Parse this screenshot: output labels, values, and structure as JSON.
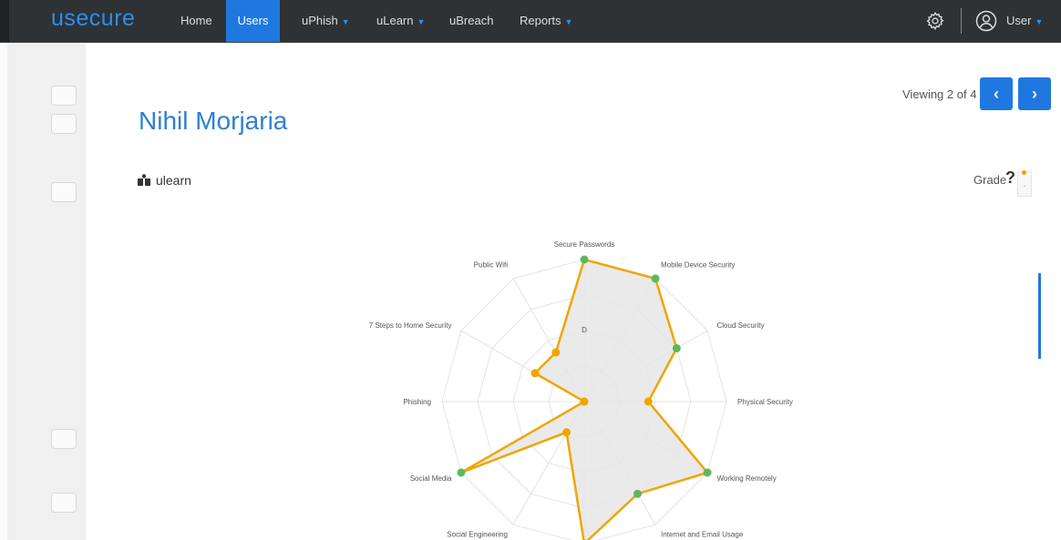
{
  "nav": {
    "logo": "usecure",
    "items": [
      {
        "label": "Home",
        "caret": false,
        "active": false
      },
      {
        "label": "Users",
        "caret": false,
        "active": true
      },
      {
        "label": "uPhish",
        "caret": true,
        "active": false
      },
      {
        "label": "uLearn",
        "caret": true,
        "active": false
      },
      {
        "label": "uBreach",
        "caret": false,
        "active": false
      },
      {
        "label": "Reports",
        "caret": true,
        "active": false
      }
    ],
    "user_label": "User",
    "icons": {
      "settings": "gear-icon",
      "user": "user-circle-icon"
    }
  },
  "pager": {
    "text": "Viewing 2 of 4",
    "prev": "‹",
    "next": "›"
  },
  "user_name": "Nihil Morjaria",
  "section": {
    "label": "ulearn",
    "icon": "ulearn-icon"
  },
  "grade": {
    "label": "Grade",
    "help": "?",
    "value": "-"
  },
  "colors": {
    "accent": "#1e78e0",
    "line": "#f0a500",
    "passed": "#5cb85c",
    "failed": "#f0a500",
    "fill": "#e6e6e6"
  },
  "chart_data": {
    "type": "radar",
    "center_label": "D",
    "axes": [
      "Secure Passwords",
      "Mobile Device Security",
      "Cloud Security",
      "Physical Security",
      "Working Remotely",
      "Internet and Email Usage",
      "",
      "Social Engineering",
      "Social Media",
      "Phishing",
      "7 Steps to Home Security",
      "Public Wifi"
    ],
    "values": [
      100,
      100,
      75,
      45,
      100,
      75,
      100,
      25,
      100,
      0,
      40,
      40
    ],
    "point_status": [
      "pass",
      "pass",
      "pass",
      "fail",
      "pass",
      "pass",
      "pass",
      "fail",
      "pass",
      "fail",
      "fail",
      "fail"
    ],
    "rings": 4
  }
}
